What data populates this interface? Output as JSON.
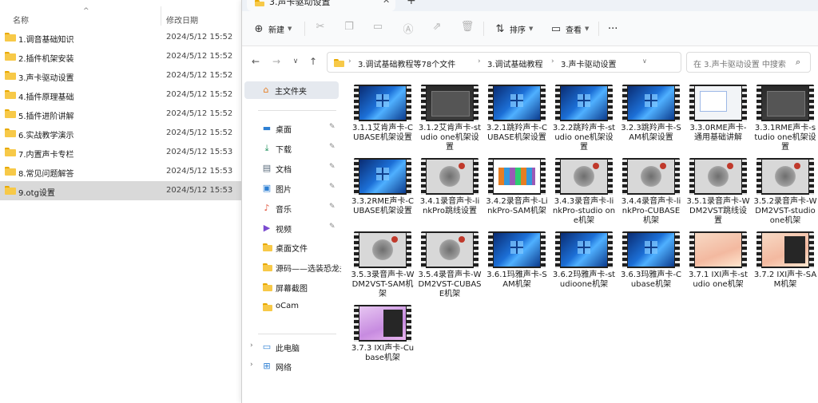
{
  "left_list": {
    "header": {
      "name": "名称",
      "date": "修改日期",
      "sort_arrow": "^"
    },
    "rows": [
      {
        "name": "1.调音基础知识",
        "date": "2024/5/12 15:52"
      },
      {
        "name": "2.插件机架安装",
        "date": "2024/5/12 15:52"
      },
      {
        "name": "3.声卡驱动设置",
        "date": "2024/5/12 15:52"
      },
      {
        "name": "4.插件原理基础",
        "date": "2024/5/12 15:52"
      },
      {
        "name": "5.插件进阶讲解",
        "date": "2024/5/12 15:52"
      },
      {
        "name": "6.实战教学演示",
        "date": "2024/5/12 15:52"
      },
      {
        "name": "7.内置声卡专栏",
        "date": "2024/5/12 15:53"
      },
      {
        "name": "8.常见问题解答",
        "date": "2024/5/12 15:53"
      },
      {
        "name": "9.otg设置",
        "date": "2024/5/12 15:53"
      }
    ]
  },
  "window": {
    "tab": {
      "title": "3.声卡驱动设置",
      "close": "✕",
      "new_tab": "+"
    },
    "commandbar": {
      "new_label": "新建",
      "sort_label": "排序",
      "view_label": "查看",
      "more": "···"
    },
    "address": {
      "crumbs": [
        "3.调试基础教程等78个文件",
        "3.调试基础教程",
        "3.声卡驱动设置"
      ],
      "search_placeholder": "在 3.声卡驱动设置 中搜索"
    },
    "nav": {
      "home": "主文件夹",
      "quick": [
        {
          "label": "桌面",
          "icon": "desktop-icon",
          "glyph": "▬",
          "color": "#2d7fd3"
        },
        {
          "label": "下载",
          "icon": "download-icon",
          "glyph": "⤓",
          "color": "#1b8f5a"
        },
        {
          "label": "文档",
          "icon": "document-icon",
          "glyph": "▤",
          "color": "#5a6b7b"
        },
        {
          "label": "图片",
          "icon": "pictures-icon",
          "glyph": "▣",
          "color": "#2d7fd3"
        },
        {
          "label": "音乐",
          "icon": "music-icon",
          "glyph": "♪",
          "color": "#e0533a"
        },
        {
          "label": "视频",
          "icon": "video-icon",
          "glyph": "▶",
          "color": "#7b4bd0"
        }
      ],
      "folders": [
        "桌面文件",
        "源码——选装恐龙头",
        "屏幕截图",
        "oCam"
      ],
      "this_pc": "此电脑",
      "network": "网络"
    },
    "files": [
      {
        "label": "3.1.1艾肯声卡-CUBASE机架设置",
        "thumb": "win"
      },
      {
        "label": "3.1.2艾肯声卡-studio one机架设置",
        "thumb": "dark"
      },
      {
        "label": "3.2.1跳羚声卡-CUBASE机架设置",
        "thumb": "win"
      },
      {
        "label": "3.2.2跳羚声卡-studio one机架设置",
        "thumb": "win"
      },
      {
        "label": "3.2.3跳羚声卡-SAM机架设置",
        "thumb": "win"
      },
      {
        "label": "3.3.0RME声卡-通用基础讲解",
        "thumb": "white"
      },
      {
        "label": "3.3.1RME声卡-studio one机架设置",
        "thumb": "dark"
      },
      {
        "label": "3.3.2RME声卡-CUBASE机架设置",
        "thumb": "win"
      },
      {
        "label": "3.4.1录音声卡-linkPro跳线设置",
        "thumb": "art"
      },
      {
        "label": "3.4.2录音声卡-LinkPro-SAM机架",
        "thumb": "colorful"
      },
      {
        "label": "3.4.3录音声卡-linkPro-studio one机架",
        "thumb": "art"
      },
      {
        "label": "3.4.4录音声卡-linkPro-CUBASE机架",
        "thumb": "art"
      },
      {
        "label": "3.5.1录音声卡-WDM2VST跳线设置",
        "thumb": "art"
      },
      {
        "label": "3.5.2录音声卡-WDM2VST-studio one机架",
        "thumb": "art"
      },
      {
        "label": "3.5.3录音声卡-WDM2VST-SAM机架",
        "thumb": "art"
      },
      {
        "label": "3.5.4录音声卡-WDM2VST-CUBASE机架",
        "thumb": "art"
      },
      {
        "label": "3.6.1玛雅声卡-SAM机架",
        "thumb": "win"
      },
      {
        "label": "3.6.2玛雅声卡-studioone机架",
        "thumb": "win"
      },
      {
        "label": "3.6.3玛雅声卡-Cubase机架",
        "thumb": "win"
      },
      {
        "label": "3.7.1 IXI声卡-studio one机架",
        "thumb": "peach"
      },
      {
        "label": "3.7.2 IXI声卡-SAM机架",
        "thumb": "peach-dark"
      },
      {
        "label": "3.7.3 IXI声卡-Cubase机架",
        "thumb": "purple"
      }
    ]
  }
}
